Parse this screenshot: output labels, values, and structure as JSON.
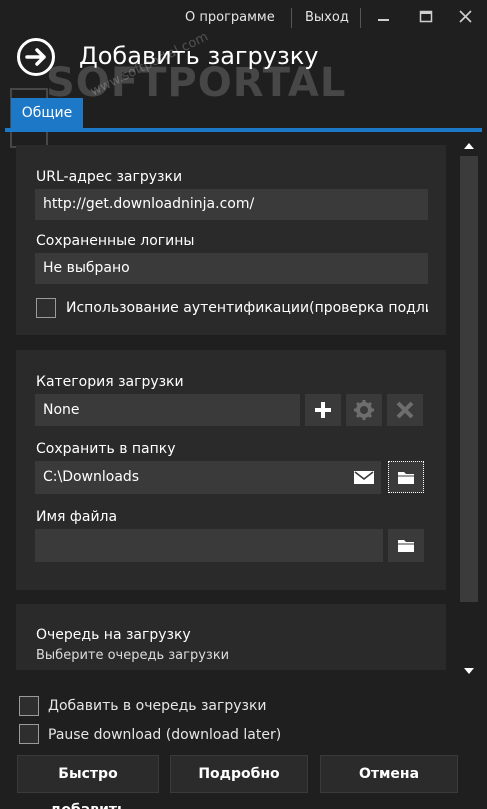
{
  "titlebar": {
    "about_label": "О программе",
    "exit_label": "Выход"
  },
  "header": {
    "title": "Добавить загрузку"
  },
  "watermark": {
    "logo_text": "SOFTPORTAL",
    "url_text": "www.softportal.com"
  },
  "tabs": [
    {
      "label": "Общие",
      "active": true
    }
  ],
  "accent_color": "#1e78c8",
  "download_section": {
    "url_label": "URL-адрес загрузки",
    "url_value": "http://get.downloadninja.com/",
    "logins_label": "Сохраненные логины",
    "logins_value": "Не выбрано",
    "auth_checkbox_label": "Использование аутентификации(проверка подлинно",
    "auth_checked": false
  },
  "category_section": {
    "category_label": "Категория загрузки",
    "category_value": "None",
    "folder_label": "Сохранить в папку",
    "folder_value": "C:\\Downloads",
    "filename_label": "Имя файла",
    "filename_value": ""
  },
  "queue_section": {
    "title": "Очередь на загрузку",
    "subtitle": "Выберите очередь загрузки"
  },
  "options": {
    "add_to_queue_label": "Добавить в очередь загрузки",
    "add_to_queue_checked": false,
    "pause_label": "Pause download (download later)",
    "pause_checked": false
  },
  "buttons": {
    "quick_add": "Быстро добавить",
    "details": "Подробно",
    "cancel": "Отмена"
  }
}
